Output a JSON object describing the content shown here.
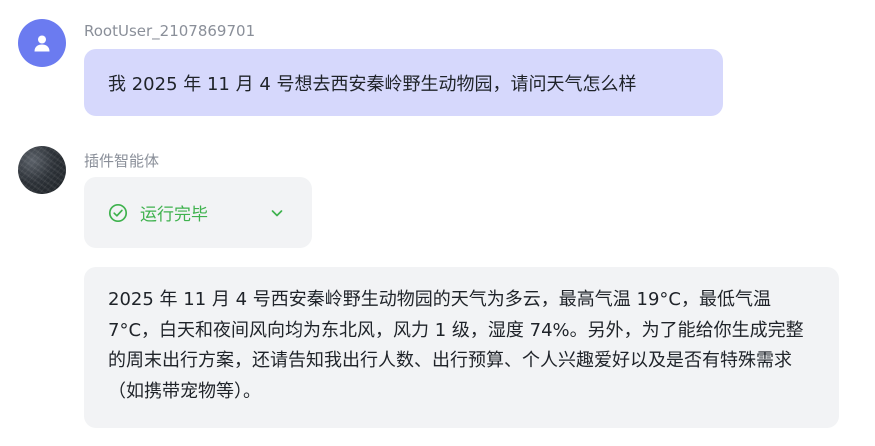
{
  "user_message": {
    "sender": "RootUser_2107869701",
    "avatar_icon": "user-icon",
    "avatar_color": "#6b7bf0",
    "bubble_color": "#d6d8fc",
    "text": "我 2025 年 11 月 4 号想去西安秦岭野生动物园，请问天气怎么样"
  },
  "bot_message": {
    "sender": "插件智能体",
    "status": {
      "icon": "check-circle-icon",
      "label": "运行完毕",
      "color": "#3fb24e",
      "toggle_icon": "chevron-down-icon"
    },
    "bubble_color": "#f2f3f5",
    "text": "2025 年 11 月 4 号西安秦岭野生动物园的天气为多云，最高气温 19°C，最低气温 7°C，白天和夜间风向均为东北风，风力 1 级，湿度 74%。另外，为了能给你生成完整的周末出行方案，还请告知我出行人数、出行预算、个人兴趣爱好以及是否有特殊需求（如携带宠物等）。"
  }
}
